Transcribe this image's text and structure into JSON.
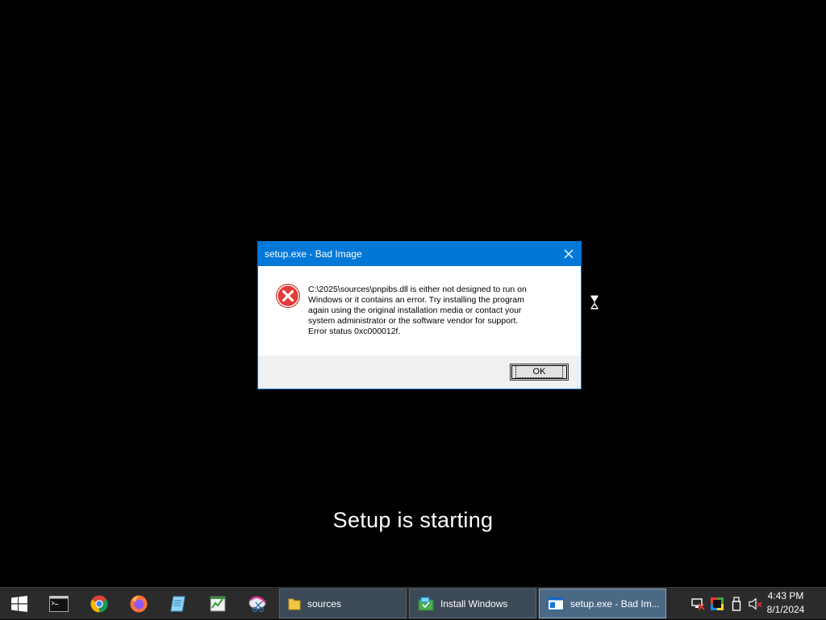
{
  "dialog": {
    "title": "setup.exe - Bad Image",
    "message": "C:\\2025\\sources\\pnpibs.dll is either not designed to run on\nWindows or it contains an error. Try installing the program\nagain using the original installation media or contact your\nsystem administrator or the software vendor for support.\nError status 0xc000012f.",
    "ok_label": "OK",
    "icon": "error-icon"
  },
  "background": {
    "status_text": "Setup is starting"
  },
  "taskbar": {
    "pinned": [
      {
        "name": "start-button",
        "icon": "windows-logo-icon"
      },
      {
        "name": "cmd",
        "icon": "command-prompt-icon"
      },
      {
        "name": "chrome",
        "icon": "chrome-icon"
      },
      {
        "name": "firefox",
        "icon": "firefox-icon"
      },
      {
        "name": "notepad",
        "icon": "notepad-icon"
      },
      {
        "name": "monitor",
        "icon": "resource-monitor-icon"
      },
      {
        "name": "snipping",
        "icon": "snipping-tool-icon"
      }
    ],
    "tasks": [
      {
        "label": "sources",
        "icon": "folder-icon",
        "active": false
      },
      {
        "label": "Install Windows",
        "icon": "install-windows-icon",
        "active": false
      },
      {
        "label": "setup.exe - Bad Im...",
        "icon": "window-icon",
        "active": true
      }
    ],
    "tray": [
      "network-icon",
      "color-icon",
      "usb-icon",
      "volume-muted-icon"
    ],
    "clock": {
      "time": "4:43 PM",
      "date": "8/1/2024"
    }
  },
  "colors": {
    "titlebar": "#0078d7",
    "error_red": "#d32f2f",
    "taskbar_bg": "#2b2b2b"
  }
}
